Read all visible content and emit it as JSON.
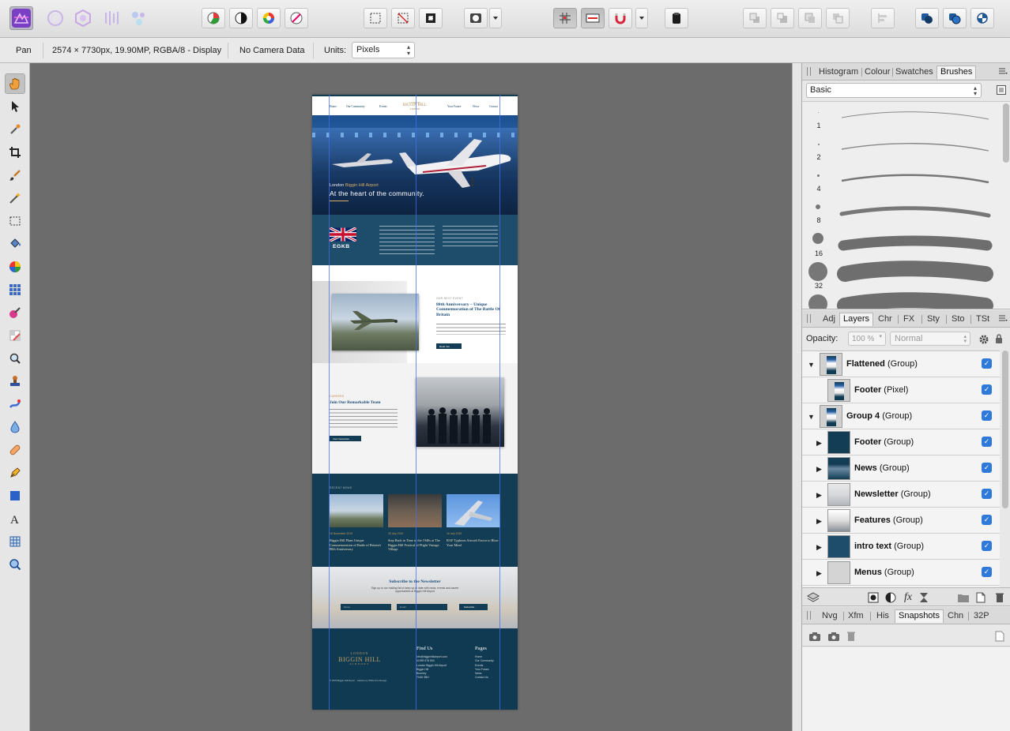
{
  "toolbar": {
    "personas": [
      "photo-persona",
      "liquify-persona",
      "develop-persona",
      "tone-mapping-persona",
      "export-persona"
    ],
    "groups": [
      "color-tools",
      "selection-tools",
      "snapping",
      "arrange"
    ]
  },
  "context": {
    "tool_name": "Pan",
    "doc_info": "2574 × 7730px, 19.90MP, RGBA/8 - Display",
    "camera": "No Camera Data",
    "units_label": "Units:",
    "units_value": "Pixels"
  },
  "brushes_panel": {
    "tabs": [
      "Histogram",
      "Colour",
      "Swatches",
      "Brushes"
    ],
    "active_tab": "Brushes",
    "category": "Basic",
    "sizes": [
      "1",
      "2",
      "4",
      "8",
      "16",
      "32"
    ]
  },
  "layers_panel": {
    "tabs": [
      "Adj",
      "Layers",
      "Chr",
      "FX",
      "Sty",
      "Sto",
      "TSt"
    ],
    "active_tab": "Layers",
    "opacity_label": "Opacity:",
    "opacity_value": "100 %",
    "blend_mode": "Normal",
    "layers": [
      {
        "name": "Flattened",
        "kind": "(Group)",
        "indent": 0,
        "expanded": true
      },
      {
        "name": "Footer",
        "kind": "(Pixel)",
        "indent": 1,
        "expanded": false
      },
      {
        "name": "Group 4",
        "kind": "(Group)",
        "indent": 0,
        "expanded": true
      },
      {
        "name": "Footer",
        "kind": "(Group)",
        "indent": 1,
        "expanded": false
      },
      {
        "name": "News",
        "kind": "(Group)",
        "indent": 1,
        "expanded": false
      },
      {
        "name": "Newsletter",
        "kind": "(Group)",
        "indent": 1,
        "expanded": false
      },
      {
        "name": "Features",
        "kind": "(Group)",
        "indent": 1,
        "expanded": false
      },
      {
        "name": "intro text",
        "kind": "(Group)",
        "indent": 1,
        "expanded": false
      },
      {
        "name": "Menus",
        "kind": "(Group)",
        "indent": 1,
        "expanded": false
      }
    ]
  },
  "bottom_panel": {
    "tabs": [
      "Nvg",
      "Xfm",
      "His",
      "Snapshots",
      "Chn",
      "32P"
    ],
    "active_tab": "Snapshots"
  },
  "document": {
    "nav_items": [
      "Home",
      "Our Community",
      "Events",
      "Your Future",
      "News",
      "Contact"
    ],
    "logo": [
      "LONDON",
      "BIGGIN HILL",
      "AIRPORT"
    ],
    "hero_kicker_pre": "London ",
    "hero_kicker_gold": "Biggin Hill Airport",
    "hero_title": "At the heart of the community.",
    "intro_code": "EGKB",
    "event_kicker": "OUR NEXT EVENT",
    "event_title": "80th Anniversary – Unique Commemoration of The Battle Of Britain",
    "event_button": "Read Info",
    "team_kicker": "CAREERS",
    "team_title": "Join Our Remarkable Team",
    "team_button": "View Vacancies",
    "news_kicker": "RECENT NEWS",
    "news": [
      {
        "date": "18 November 2019",
        "title": "Biggin Hill Plans Unique Commemoration of Battle of Britain's 80th Anniversary"
      },
      {
        "date": "25 July 2019",
        "title": "Step Back in Time to the 1940s at The Biggin Hill Festival of Flight Vintage Village"
      },
      {
        "date": "16 July 2019",
        "title": "RAF Typhoon Aircraft Factor to Blow Your Mind"
      }
    ],
    "newsletter_title": "Subscribe to the Newsletter",
    "newsletter_sub": "Sign up to our mailing list to keep up to date with news, events and career opportunities at Biggin Hill Airport",
    "newsletter_name": "Name",
    "newsletter_email": "Email",
    "newsletter_button": "Subscribe",
    "footer_find": "Find Us",
    "footer_pages": "Pages",
    "footer_contact": [
      "info@bigginhillairport.com",
      "01959 578 500",
      "London Biggin Hill Airport",
      "Biggin Hill",
      "Bromley",
      "TN16 3BH"
    ],
    "footer_links": [
      "Home",
      "Our Community",
      "Events",
      "Your Future",
      "News",
      "Contact Us"
    ],
    "footer_copy": "© 2020 Biggin Hill Airport · website by White Fire Design"
  }
}
